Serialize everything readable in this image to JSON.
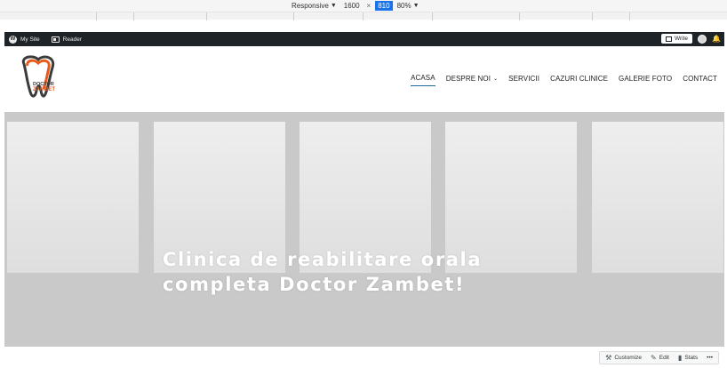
{
  "devtools": {
    "device": "Responsive",
    "width": "1600",
    "height": "810",
    "zoom": "80%"
  },
  "adminbar": {
    "my_site": "My Site",
    "reader": "Reader",
    "write": "Write"
  },
  "header": {
    "logo": {
      "line1": "DOCTOR",
      "line2": "ZAMBET"
    },
    "nav": [
      {
        "label": "ACASA",
        "active": true
      },
      {
        "label": "DESPRE NOI",
        "has_dropdown": true
      },
      {
        "label": "SERVICII"
      },
      {
        "label": "CAZURI CLINICE"
      },
      {
        "label": "GALERIE FOTO"
      },
      {
        "label": "CONTACT"
      }
    ]
  },
  "hero": {
    "title_line1": "Clinica de reabilitare orala",
    "title_line2": "completa Doctor Zambet!",
    "photos": [
      {
        "scrub": "#8a1e2c",
        "hair": "#2a1d18",
        "skin": "#e2b49b"
      },
      {
        "scrub": "#7f9fd6",
        "hair": "#7a3a22",
        "skin": "#efc4a8"
      },
      {
        "scrub": "#6fb9a1",
        "hair": "#c89556",
        "skin": "#f0c3a6"
      },
      {
        "scrub": "#a9c7dd",
        "hair": "#c9a187",
        "skin": "#eec7b0"
      },
      {
        "scrub": "#e14d7a",
        "hair": "#4a1f16",
        "skin": "#eeb7a5"
      }
    ]
  },
  "bottom_actions": {
    "customize": "Customize",
    "edit": "Edit",
    "stats": "Stats",
    "more": "•••"
  },
  "colors": {
    "admin_bar": "#1d2327",
    "hero_bg": "#c9c9c9",
    "nav_active_underline": "#1f6b9a",
    "logo_orange": "#e8591a",
    "logo_dark": "#3b3b3b"
  }
}
